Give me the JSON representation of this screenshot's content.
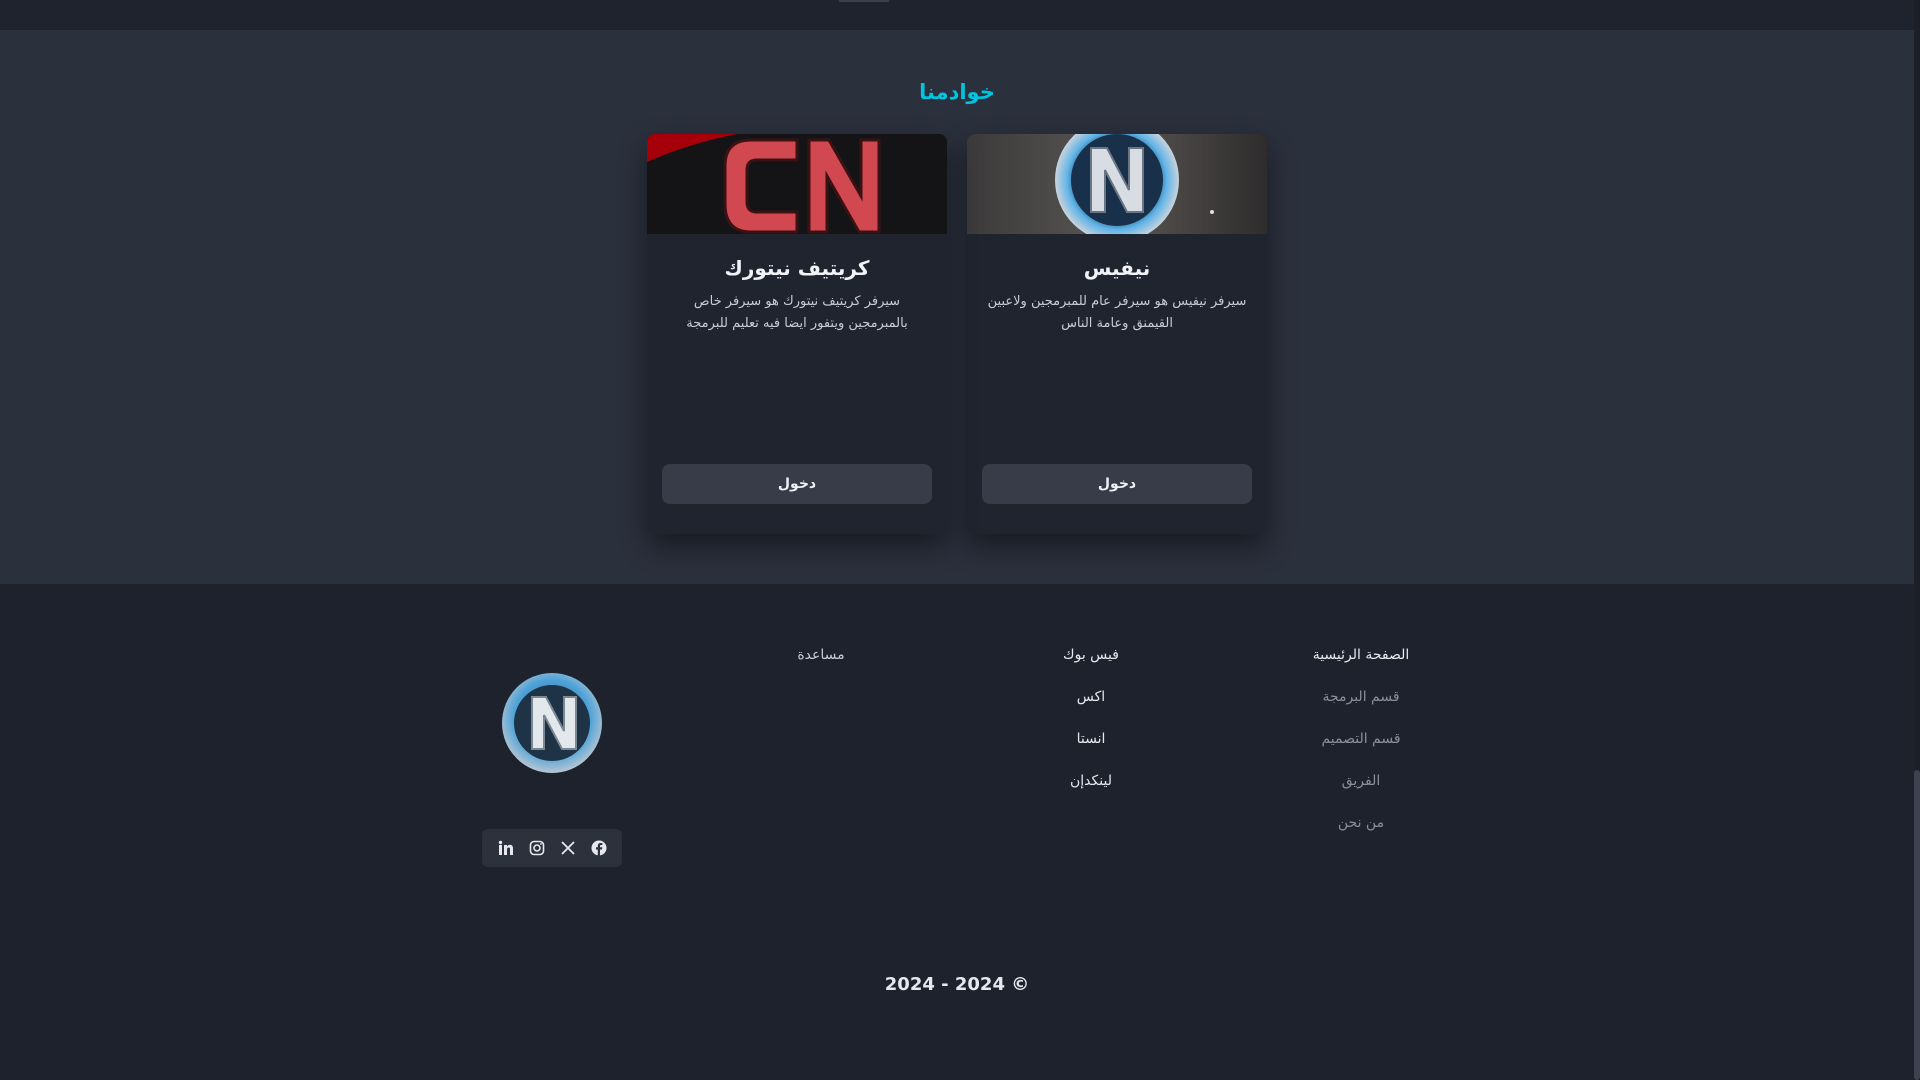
{
  "servers_section": {
    "title": "خوادمنا",
    "cards": [
      {
        "title": "نيفيس",
        "description": "سيرفر نيفيس هو سيرفر عام للمبرمجين ولاعبين القيمنق وعامة الناس",
        "button_label": "دخول",
        "banner_icon": "nexus-emblem"
      },
      {
        "title": "كريتيف نيتورك",
        "description": "سيرفر كريتيف نيتورك هو سيرفر خاص بالمبرمجين ويتفور ايضا فيه تعليم للبرمجة",
        "button_label": "دخول",
        "banner_icon": "cn-logo"
      }
    ]
  },
  "footer": {
    "nav_links": [
      "الصفحة الرئيسية",
      "قسم البرمجة",
      "قسم التصميم",
      "الفريق",
      "من نحن"
    ],
    "social_links": [
      "فيس بوك",
      "اكس",
      "انستا",
      "لينكدإن"
    ],
    "help_links": [
      "مساعدة"
    ],
    "social_icons": [
      "facebook-icon",
      "x-icon",
      "instagram-icon",
      "linkedin-icon"
    ],
    "copyright": "2024 - 2024 ©"
  },
  "colors": {
    "accent": "#00c4e0",
    "section_bg": "#2b303d",
    "page_bg": "#1e222c",
    "card_bg": "#20242f",
    "button_bg": "#373c48"
  }
}
